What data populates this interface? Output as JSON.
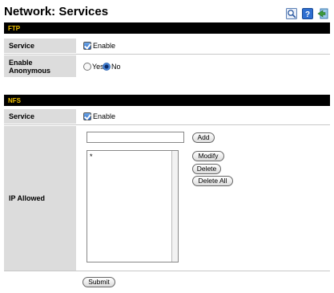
{
  "page": {
    "title": "Network: Services"
  },
  "toolbar": {
    "icons": [
      "zoom-icon",
      "help-icon",
      "exit-icon"
    ]
  },
  "ftp": {
    "header": "FTP",
    "service_label": "Service",
    "service_option": "Enable",
    "service_checked": true,
    "anonymous_label_line1": "Enable",
    "anonymous_label_line2": "Anonymous",
    "yes_label": "Yes",
    "no_label": "No",
    "anonymous_selected": "No"
  },
  "nfs": {
    "header": "NFS",
    "service_label": "Service",
    "service_option": "Enable",
    "service_checked": true,
    "ip_allowed_label": "IP Allowed",
    "ip_input_value": "",
    "ip_list": [
      "*"
    ],
    "add_label": "Add",
    "modify_label": "Modify",
    "delete_label": "Delete",
    "delete_all_label": "Delete All"
  },
  "form": {
    "submit_label": "Submit"
  },
  "colors": {
    "header_bg": "#000000",
    "header_text": "#f2c200",
    "label_bg": "#dcdcdc"
  }
}
